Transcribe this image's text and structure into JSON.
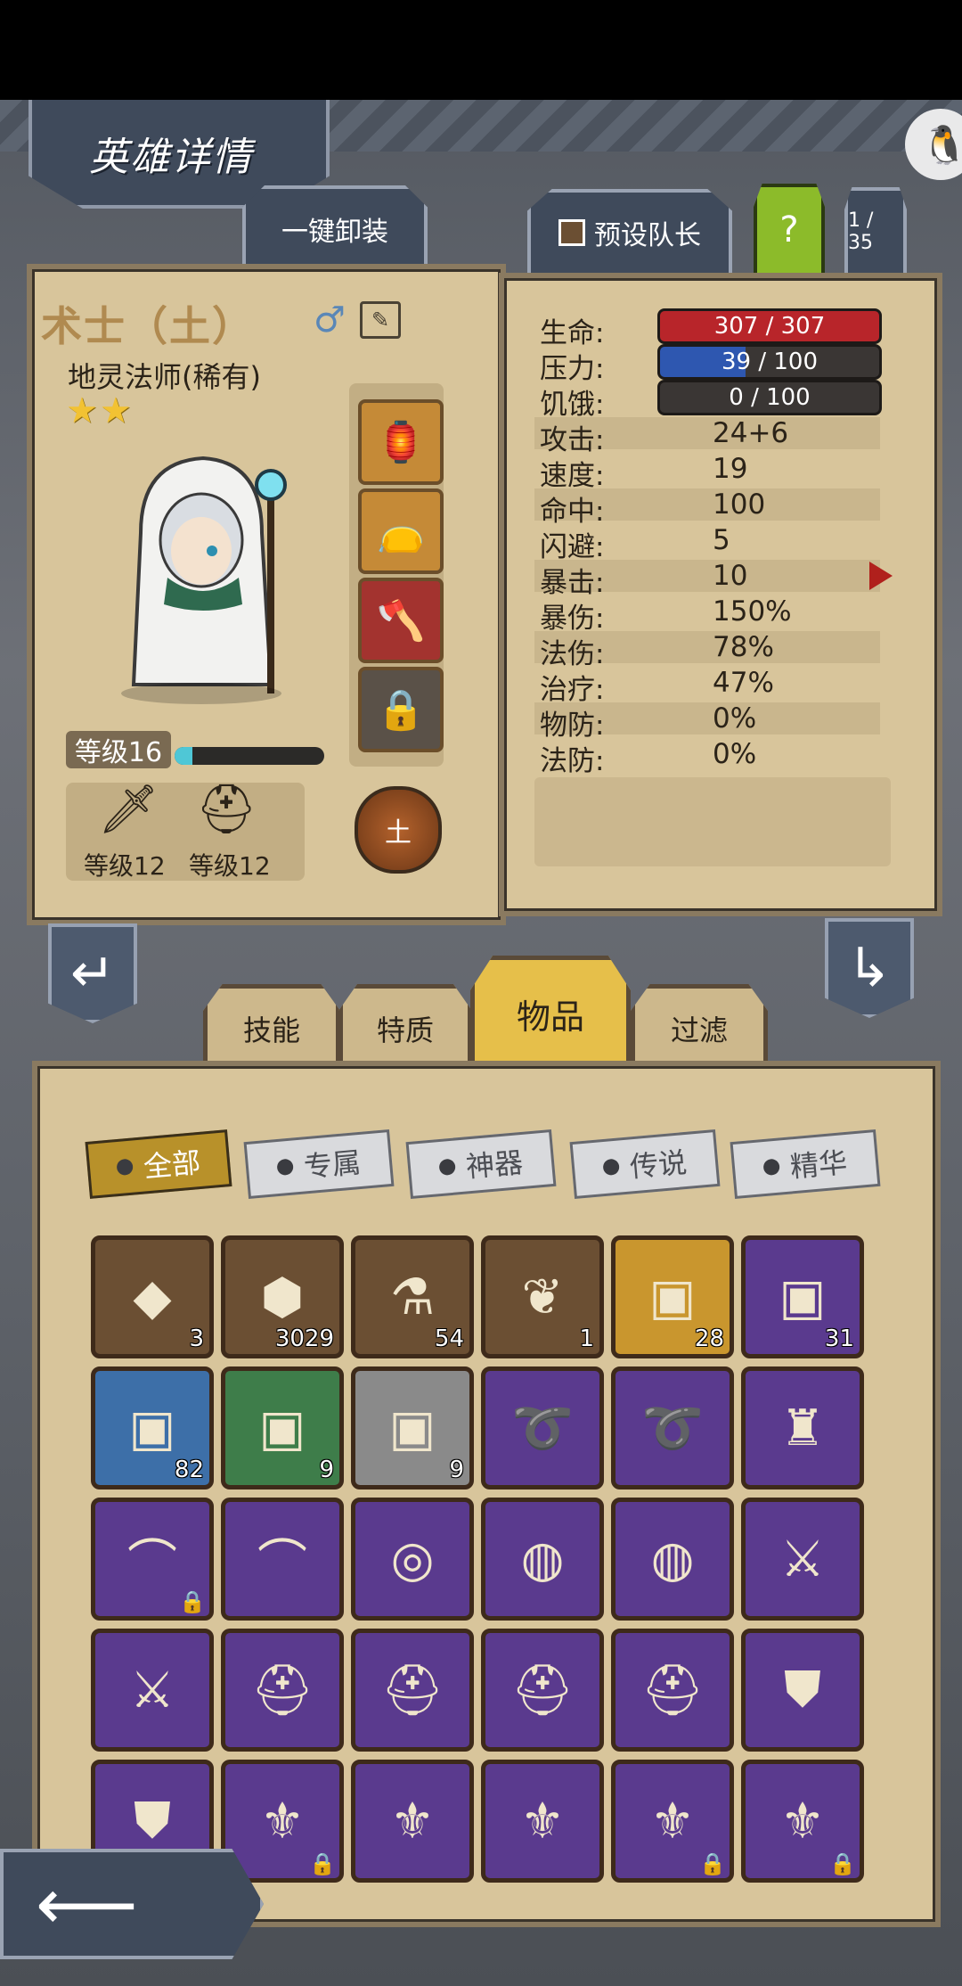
{
  "header": {
    "title": "英雄详情",
    "unequip_all": "一键卸装",
    "preset_leader": "预设队长",
    "help": "?",
    "page_counter": "1 / 35"
  },
  "hero": {
    "name": "术士（土）",
    "gender_symbol": "♂",
    "class_rarity": "地灵法师(稀有)",
    "stars": "★★",
    "level_label": "等级16",
    "xp_progress": 0.12,
    "weapon_level": "等级12",
    "armor_level": "等级12",
    "element": "土"
  },
  "stats": {
    "bars": [
      {
        "label": "生命:",
        "value": "307 / 307",
        "color": "#b8252a",
        "fill": 1.0
      },
      {
        "label": "压力:",
        "value": "39 / 100",
        "color": "#2e57b0",
        "fill": 0.39
      },
      {
        "label": "饥饿:",
        "value": "0 / 100",
        "color": "#3a3634",
        "fill": 0.0
      }
    ],
    "rows": [
      {
        "label": "攻击:",
        "value": "24+6"
      },
      {
        "label": "速度:",
        "value": "19"
      },
      {
        "label": "命中:",
        "value": "100"
      },
      {
        "label": "闪避:",
        "value": "5"
      },
      {
        "label": "暴击:",
        "value": "10"
      },
      {
        "label": "暴伤:",
        "value": "150%"
      },
      {
        "label": "法伤:",
        "value": "78%"
      },
      {
        "label": "治疗:",
        "value": "47%"
      },
      {
        "label": "物防:",
        "value": "0%"
      },
      {
        "label": "法防:",
        "value": "0%"
      }
    ]
  },
  "tabs": [
    "技能",
    "特质",
    "物品",
    "过滤"
  ],
  "filters": [
    "全部",
    "专属",
    "神器",
    "传说",
    "精华"
  ],
  "items": [
    {
      "icon": "amber-gem-icon",
      "glyph": "◆",
      "bg": "#6b4f33",
      "count": "3"
    },
    {
      "icon": "teal-shard-icon",
      "glyph": "⬢",
      "bg": "#6b4f33",
      "count": "3029"
    },
    {
      "icon": "potion-icon",
      "glyph": "⚗",
      "bg": "#6b4f33",
      "count": "54"
    },
    {
      "icon": "feather-icon",
      "glyph": "❦",
      "bg": "#6b4f33",
      "count": "1"
    },
    {
      "icon": "gold-chest-icon",
      "glyph": "▣",
      "bg": "#c9962e",
      "count": "28"
    },
    {
      "icon": "purple-chest-icon",
      "glyph": "▣",
      "bg": "#5a3a8e",
      "count": "31"
    },
    {
      "icon": "blue-chest-icon",
      "glyph": "▣",
      "bg": "#3d6fa8",
      "count": "82"
    },
    {
      "icon": "green-chest-icon",
      "glyph": "▣",
      "bg": "#3e7d4a",
      "count": "9"
    },
    {
      "icon": "gray-chest-icon",
      "glyph": "▣",
      "bg": "#8a8a8a",
      "count": "9"
    },
    {
      "icon": "whip-icon",
      "glyph": "➰",
      "bg": "#5a3a8e",
      "count": ""
    },
    {
      "icon": "whip-icon",
      "glyph": "➰",
      "bg": "#5a3a8e",
      "count": ""
    },
    {
      "icon": "spiked-armor-icon",
      "glyph": "♜",
      "bg": "#5a3a8e",
      "count": ""
    },
    {
      "icon": "claw-necklace-icon",
      "glyph": "⌒",
      "bg": "#5a3a8e",
      "count": "",
      "locked": true
    },
    {
      "icon": "claw-necklace-icon",
      "glyph": "⌒",
      "bg": "#5a3a8e",
      "count": ""
    },
    {
      "icon": "red-band-icon",
      "glyph": "◎",
      "bg": "#5a3a8e",
      "count": ""
    },
    {
      "icon": "crystal-ring-icon",
      "glyph": "◍",
      "bg": "#5a3a8e",
      "count": ""
    },
    {
      "icon": "crystal-ring-icon",
      "glyph": "◍",
      "bg": "#5a3a8e",
      "count": ""
    },
    {
      "icon": "ice-sword-icon",
      "glyph": "⚔",
      "bg": "#5a3a8e",
      "count": ""
    },
    {
      "icon": "ice-sword-icon",
      "glyph": "⚔",
      "bg": "#5a3a8e",
      "count": ""
    },
    {
      "icon": "gold-helmet-icon",
      "glyph": "⛑",
      "bg": "#5a3a8e",
      "count": ""
    },
    {
      "icon": "gold-helmet-icon",
      "glyph": "⛑",
      "bg": "#5a3a8e",
      "count": ""
    },
    {
      "icon": "gold-helmet-icon",
      "glyph": "⛑",
      "bg": "#5a3a8e",
      "count": ""
    },
    {
      "icon": "gold-helmet-icon",
      "glyph": "⛑",
      "bg": "#5a3a8e",
      "count": ""
    },
    {
      "icon": "gold-pauldron-icon",
      "glyph": "⛊",
      "bg": "#5a3a8e",
      "count": ""
    },
    {
      "icon": "gold-pauldron-icon",
      "glyph": "⛊",
      "bg": "#5a3a8e",
      "count": ""
    },
    {
      "icon": "winged-boots-icon",
      "glyph": "⚜",
      "bg": "#5a3a8e",
      "count": "",
      "locked": true
    },
    {
      "icon": "winged-boots-icon",
      "glyph": "⚜",
      "bg": "#5a3a8e",
      "count": ""
    },
    {
      "icon": "winged-boots-icon",
      "glyph": "⚜",
      "bg": "#5a3a8e",
      "count": ""
    },
    {
      "icon": "winged-boots-icon",
      "glyph": "⚜",
      "bg": "#5a3a8e",
      "count": "",
      "locked": true
    },
    {
      "icon": "winged-boots-icon",
      "glyph": "⚜",
      "bg": "#5a3a8e",
      "count": "",
      "locked": true
    }
  ]
}
